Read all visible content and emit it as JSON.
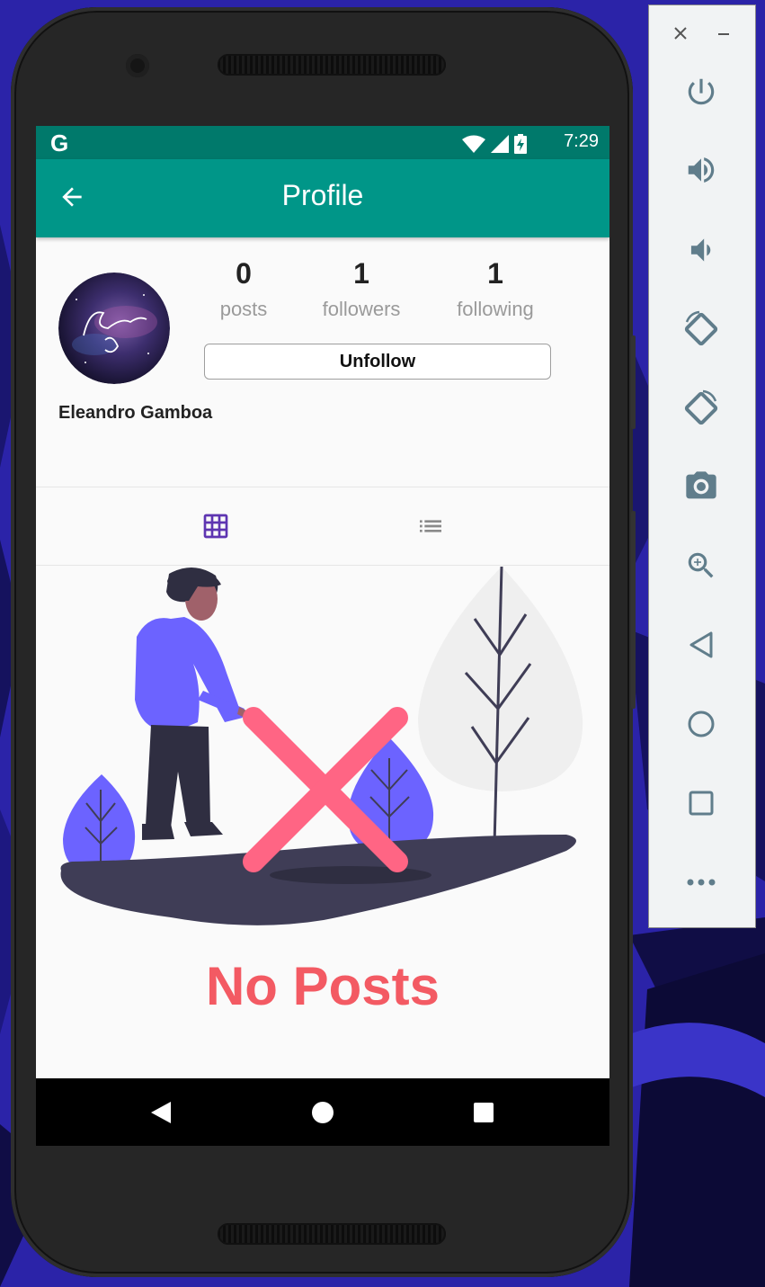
{
  "status_bar": {
    "g_logo": "G",
    "time": "7:29"
  },
  "app_bar": {
    "title": "Profile",
    "back_icon": "arrow-back-icon"
  },
  "profile": {
    "name": "Eleandro Gamboa",
    "stats": [
      {
        "value": "0",
        "label": "posts"
      },
      {
        "value": "1",
        "label": "followers"
      },
      {
        "value": "1",
        "label": "following"
      }
    ],
    "follow_button_label": "Unfollow"
  },
  "tabs": [
    {
      "icon": "grid-icon",
      "active": true
    },
    {
      "icon": "list-icon",
      "active": false
    }
  ],
  "empty_state": {
    "message": "No Posts"
  },
  "emulator_panel": {
    "buttons": [
      "close-icon",
      "minimize-icon",
      "power-icon",
      "volume-up-icon",
      "volume-down-icon",
      "rotate-left-icon",
      "rotate-right-icon",
      "camera-icon",
      "zoom-icon",
      "back-icon",
      "home-icon",
      "overview-icon",
      "more-icon"
    ]
  },
  "colors": {
    "primary": "#009688",
    "primary_dark": "#00796b",
    "accent": "#5e35b1",
    "empty_text": "#f35a63",
    "background": "#2b23a8"
  }
}
